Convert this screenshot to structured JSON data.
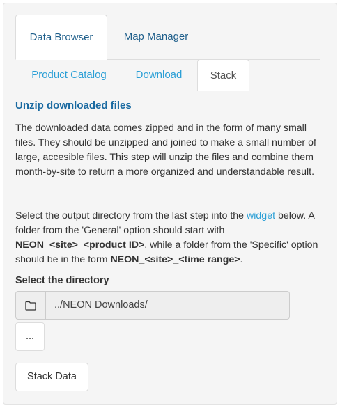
{
  "tabs": {
    "top": [
      {
        "label": "Data Browser",
        "active": true
      },
      {
        "label": "Map Manager",
        "active": false
      }
    ],
    "sub": [
      {
        "label": "Product Catalog",
        "active": false
      },
      {
        "label": "Download",
        "active": false
      },
      {
        "label": "Stack",
        "active": true
      }
    ]
  },
  "stack": {
    "heading": "Unzip downloaded files",
    "intro": "The downloaded data comes zipped and in the form of many small files. They should be unzipped and joined to make a small number of large, accesible files. This step will unzip the files and combine them month-by-site to return a more organized and understandable result.",
    "instructions": {
      "part1": "Select the output directory from the last step into the ",
      "widget_link": "widget",
      "part2": " below. A folder from the 'General' option should start with ",
      "general_format": "NEON_<site>_<product ID>",
      "part3": ", while a folder from the 'Specific' option should be in the form ",
      "specific_format": "NEON_<site>_<time range>",
      "part4": "."
    },
    "directory_label": "Select the directory",
    "directory_value": "../NEON Downloads/",
    "browse_label": "...",
    "stack_button": "Stack Data"
  },
  "icons": {
    "folder": "folder-icon"
  },
  "colors": {
    "link": "#2a9fd6",
    "heading": "#1a6aa1",
    "panel_bg": "#f5f5f5"
  }
}
